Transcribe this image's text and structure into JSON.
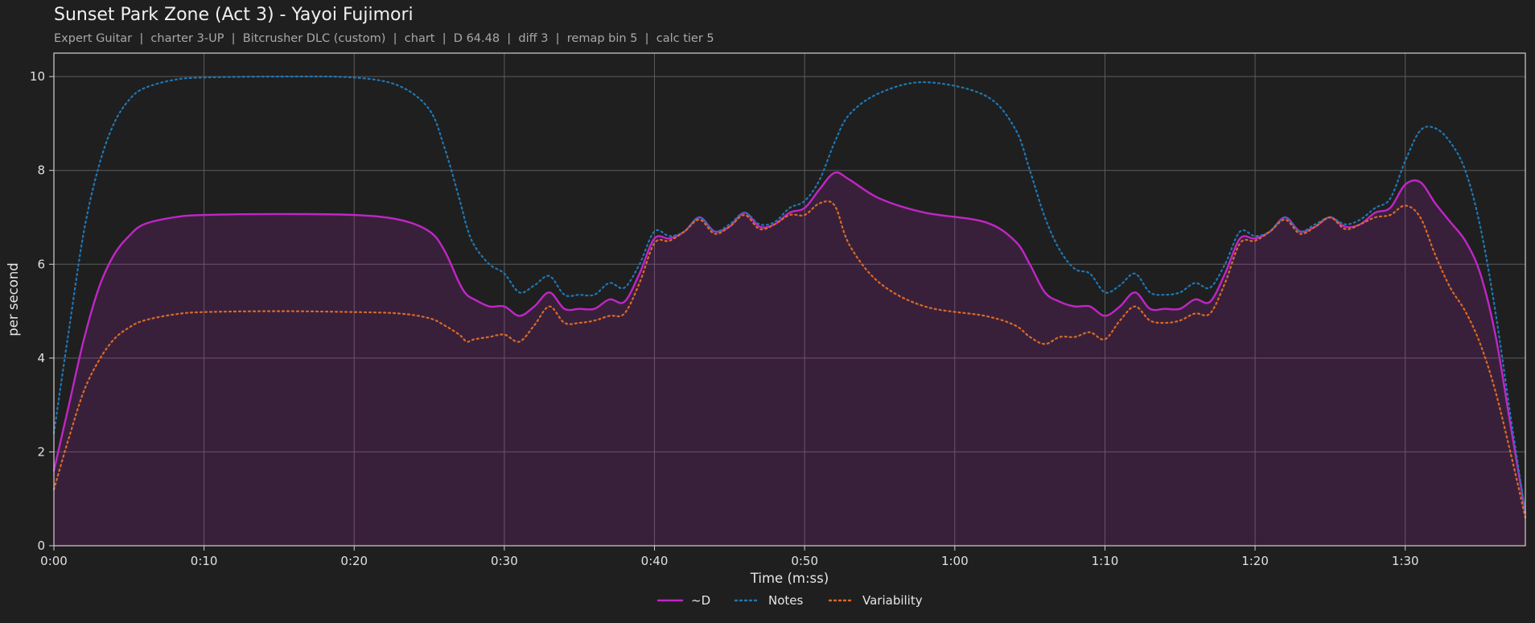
{
  "header": {
    "title": "Sunset Park Zone (Act 3) - Yayoi Fujimori",
    "subtitle": "Expert Guitar  |  charter 3-UP  |  Bitcrusher DLC (custom)  |  chart  |  D 64.48  |  diff 3  |  remap bin 5  |  calc tier 5"
  },
  "chart_data": {
    "type": "line",
    "xlabel": "Time (m:ss)",
    "ylabel": "per second",
    "xlim": [
      0,
      98
    ],
    "ylim": [
      0,
      10.5
    ],
    "x_ticks": [
      0,
      10,
      20,
      30,
      40,
      50,
      60,
      70,
      80,
      90
    ],
    "x_tick_labels": [
      "0:00",
      "0:10",
      "0:20",
      "0:30",
      "0:40",
      "0:50",
      "1:00",
      "1:10",
      "1:20",
      "1:30"
    ],
    "y_ticks": [
      0,
      2,
      4,
      6,
      8,
      10
    ],
    "y_tick_labels": [
      "0",
      "2",
      "4",
      "6",
      "8",
      "10"
    ],
    "grid": true,
    "legend_position": "bottom-center",
    "x": [
      0,
      1,
      2,
      3,
      4,
      5,
      6,
      8,
      10,
      15,
      20,
      23,
      25,
      26,
      27,
      27.5,
      28,
      29,
      30,
      31,
      32,
      33,
      34,
      35,
      36,
      37,
      38,
      39,
      40,
      41,
      42,
      43,
      44,
      45,
      46,
      47,
      48,
      49,
      50,
      51,
      52,
      53,
      55,
      58,
      62,
      64,
      65,
      66,
      67,
      68,
      69,
      70,
      71,
      72,
      73,
      74,
      75,
      76,
      77,
      78,
      79,
      80,
      81,
      82,
      83,
      84,
      85,
      86,
      87,
      88,
      89,
      90,
      91,
      92,
      93,
      94,
      95,
      96,
      97,
      98
    ],
    "series": [
      {
        "name": "~D",
        "color": "#c026c6",
        "style": "solid",
        "filled": true,
        "values": [
          1.6,
          3.0,
          4.4,
          5.5,
          6.2,
          6.6,
          6.85,
          7.0,
          7.05,
          7.07,
          7.05,
          6.95,
          6.7,
          6.3,
          5.6,
          5.35,
          5.25,
          5.1,
          5.1,
          4.9,
          5.1,
          5.4,
          5.05,
          5.05,
          5.05,
          5.25,
          5.2,
          5.8,
          6.55,
          6.55,
          6.7,
          7.0,
          6.7,
          6.8,
          7.1,
          6.8,
          6.85,
          7.1,
          7.2,
          7.6,
          7.95,
          7.8,
          7.4,
          7.1,
          6.9,
          6.5,
          6.0,
          5.4,
          5.2,
          5.1,
          5.1,
          4.9,
          5.1,
          5.4,
          5.05,
          5.05,
          5.05,
          5.25,
          5.2,
          5.8,
          6.55,
          6.55,
          6.7,
          7.0,
          6.7,
          6.8,
          7.0,
          6.8,
          6.85,
          7.1,
          7.2,
          7.7,
          7.75,
          7.3,
          6.9,
          6.5,
          5.8,
          4.5,
          2.6,
          0.7
        ]
      },
      {
        "name": "Notes",
        "color": "#1f77b4",
        "style": "dotted",
        "filled": false,
        "values": [
          2.4,
          4.6,
          6.7,
          8.1,
          9.0,
          9.5,
          9.75,
          9.93,
          9.98,
          10.0,
          9.98,
          9.8,
          9.3,
          8.5,
          7.4,
          6.8,
          6.4,
          6.0,
          5.8,
          5.4,
          5.55,
          5.75,
          5.35,
          5.35,
          5.35,
          5.6,
          5.5,
          6.0,
          6.7,
          6.6,
          6.7,
          7.0,
          6.7,
          6.85,
          7.1,
          6.85,
          6.9,
          7.2,
          7.35,
          7.8,
          8.6,
          9.2,
          9.65,
          9.88,
          9.6,
          8.9,
          8.0,
          7.0,
          6.3,
          5.9,
          5.8,
          5.4,
          5.55,
          5.8,
          5.4,
          5.35,
          5.4,
          5.6,
          5.5,
          6.0,
          6.7,
          6.6,
          6.7,
          7.0,
          6.7,
          6.85,
          7.0,
          6.85,
          6.95,
          7.2,
          7.4,
          8.2,
          8.85,
          8.9,
          8.6,
          8.0,
          6.8,
          5.0,
          2.8,
          0.7
        ]
      },
      {
        "name": "Variability",
        "color": "#d96a26",
        "style": "dotted",
        "filled": false,
        "values": [
          1.2,
          2.3,
          3.3,
          3.95,
          4.4,
          4.65,
          4.8,
          4.93,
          4.98,
          5.0,
          4.98,
          4.95,
          4.85,
          4.7,
          4.5,
          4.35,
          4.4,
          4.45,
          4.5,
          4.35,
          4.7,
          5.1,
          4.75,
          4.75,
          4.8,
          4.9,
          4.95,
          5.6,
          6.45,
          6.5,
          6.7,
          6.95,
          6.65,
          6.8,
          7.05,
          6.75,
          6.85,
          7.05,
          7.05,
          7.3,
          7.25,
          6.4,
          5.6,
          5.1,
          4.9,
          4.7,
          4.45,
          4.3,
          4.45,
          4.45,
          4.55,
          4.4,
          4.8,
          5.1,
          4.8,
          4.75,
          4.8,
          4.95,
          4.95,
          5.6,
          6.45,
          6.5,
          6.7,
          6.95,
          6.65,
          6.8,
          7.0,
          6.75,
          6.85,
          7.0,
          7.05,
          7.25,
          7.0,
          6.2,
          5.5,
          5.0,
          4.3,
          3.3,
          2.0,
          0.6
        ]
      }
    ]
  }
}
